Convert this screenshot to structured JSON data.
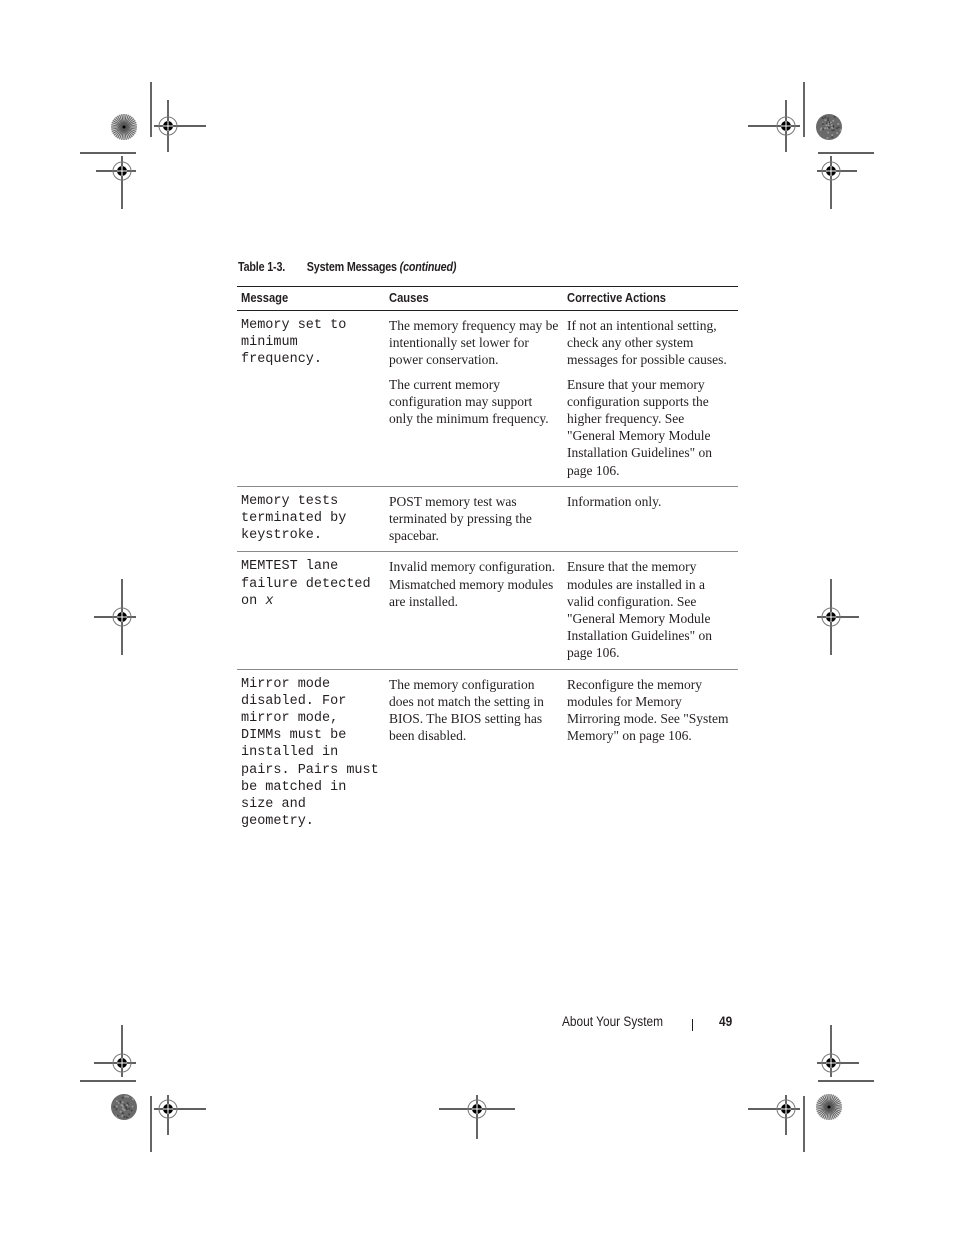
{
  "table": {
    "number": "Table 1-3.",
    "title": "System Messages",
    "continued": "(continued)",
    "columns": [
      "Message",
      "Causes",
      "Corrective Actions"
    ],
    "rows": [
      {
        "message": "Memory set to minimum frequency.",
        "entries": [
          {
            "cause": "The memory frequency may be intentionally set lower for power conservation.",
            "action": "If not an intentional setting, check any other system messages for possible causes."
          },
          {
            "cause": "The current memory configuration may support only the minimum frequency.",
            "action": "Ensure that your memory configuration supports the higher frequency. See \"General Memory Module Installation Guidelines\" on page 106."
          }
        ]
      },
      {
        "message": "Memory tests terminated by keystroke.",
        "cause": "POST memory test was terminated by pressing the spacebar.",
        "action": "Information only."
      },
      {
        "message_prefix": "MEMTEST lane failure detected on ",
        "message_var": "x",
        "cause": "Invalid memory configuration. Mismatched memory modules are installed.",
        "action": "Ensure that the memory modules are installed in a valid configuration. See \"General Memory Module Installation Guidelines\" on page 106."
      },
      {
        "message": "Mirror mode disabled. For mirror mode, DIMMs must be installed in pairs. Pairs must be matched in size and geometry.",
        "cause": "The memory configuration does not match the setting in BIOS. The BIOS setting has been disabled.",
        "action": "Reconfigure the memory modules for Memory Mirroring mode. See \"System Memory\" on page 106."
      }
    ]
  },
  "footer": {
    "section": "About Your System",
    "page_number": "49"
  },
  "print_marks": {
    "registration_marks": 10,
    "star_targets": 4,
    "crop_lines": 8
  }
}
